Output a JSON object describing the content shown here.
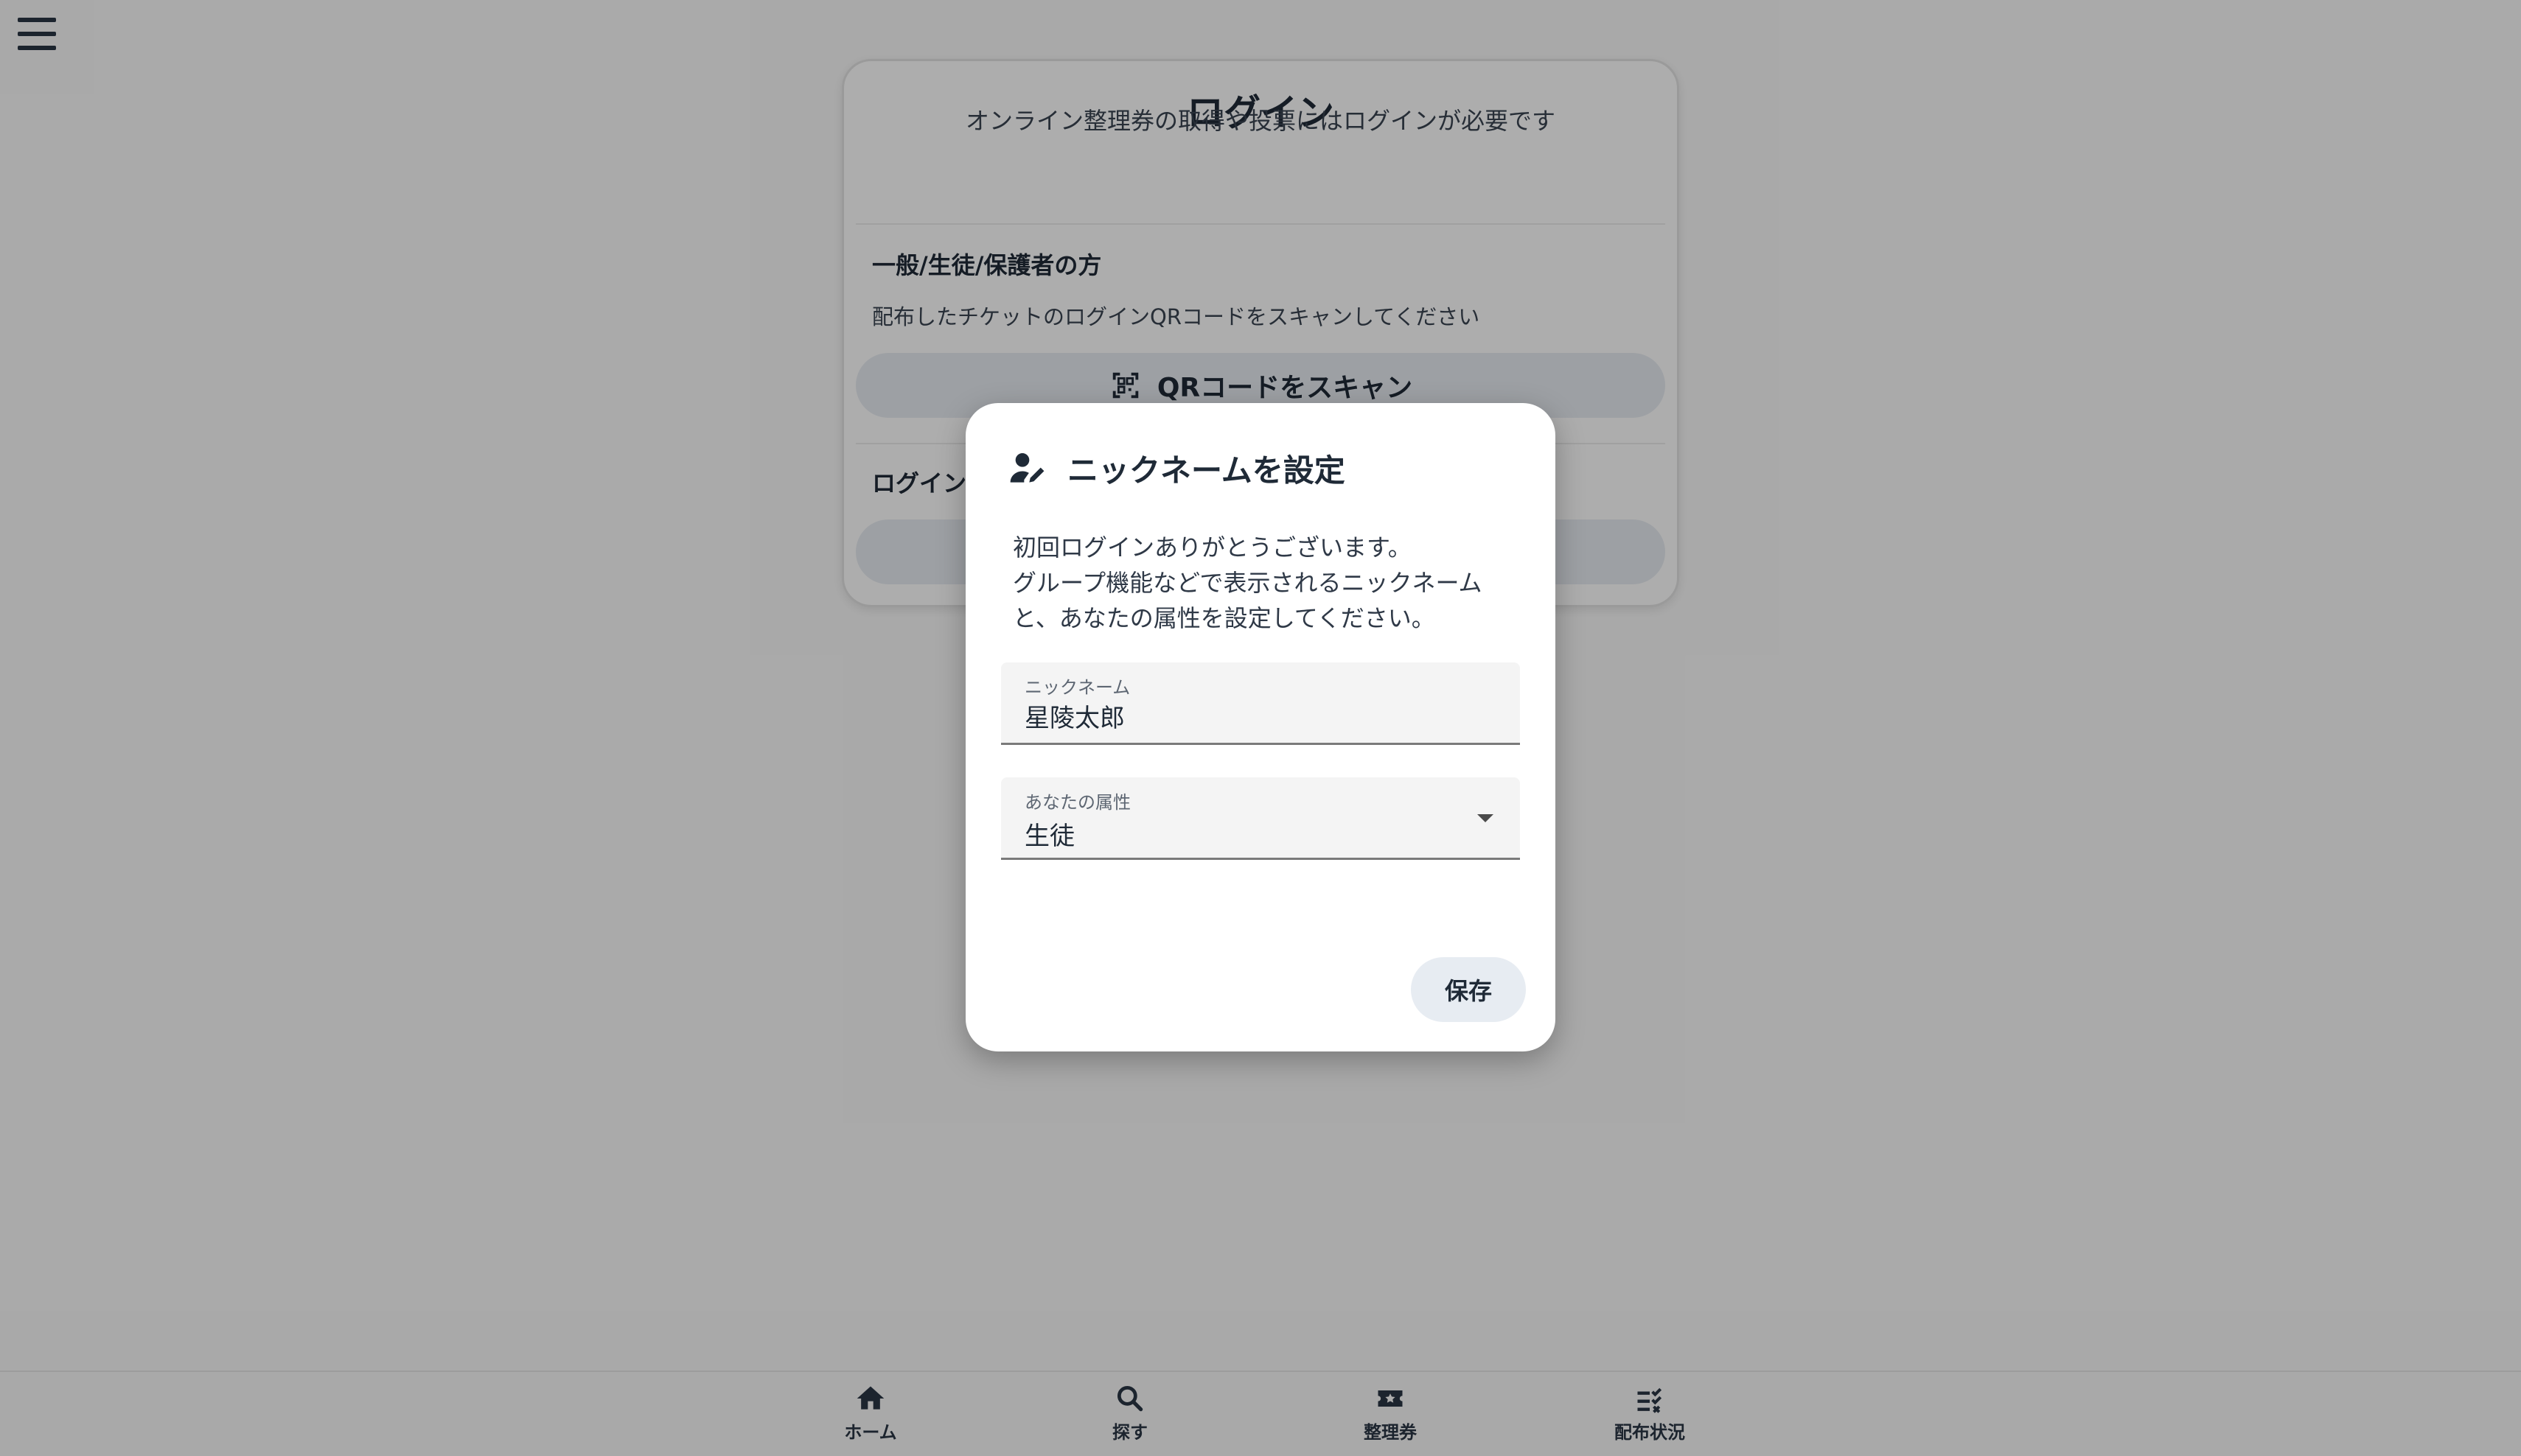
{
  "login": {
    "title": "ログイン",
    "subtitle": "オンライン整理券の取得や投票にはログインが必要です",
    "general_heading": "一般/生徒/保護者の方",
    "general_text": "配布したチケットのログインQRコードをスキャンしてください",
    "scan_button_label": "QRコードをスキャン",
    "second_heading": "ログイン"
  },
  "nav": {
    "items": [
      {
        "label": "ホーム",
        "icon": "home-icon"
      },
      {
        "label": "探す",
        "icon": "search-icon"
      },
      {
        "label": "整理券",
        "icon": "ticket-icon"
      },
      {
        "label": "配布状況",
        "icon": "checklist-icon"
      }
    ]
  },
  "dialog": {
    "title": "ニックネームを設定",
    "body_lines": [
      "初回ログインありがとうございます。",
      "グループ機能などで表示されるニックネーム",
      "と、あなたの属性を設定してください。"
    ],
    "nickname_label": "ニックネーム",
    "nickname_value": "星陵太郎",
    "attribute_label": "あなたの属性",
    "attribute_value": "生徒",
    "save_label": "保存"
  },
  "colors": {
    "text": "#1f2a37",
    "button_bg": "#e7ecf2",
    "scrim": "rgba(0,0,0,0.32)"
  }
}
